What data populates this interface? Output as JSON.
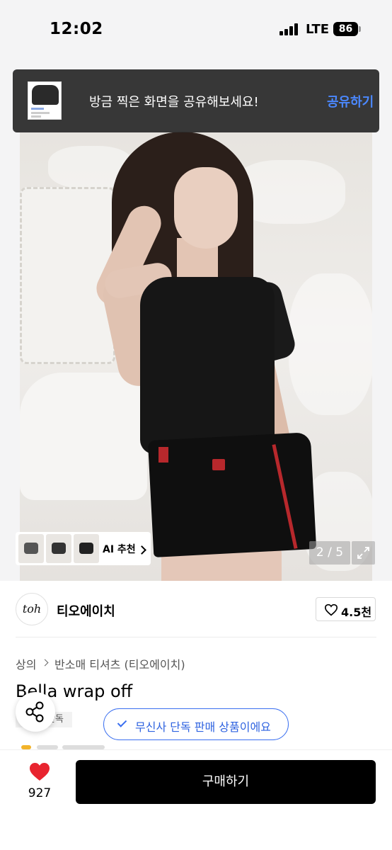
{
  "status_bar": {
    "time": "12:02",
    "network": "LTE",
    "battery": "86"
  },
  "share_toast": {
    "message": "방금 찍은 화면을 공유해보세요!",
    "action": "공유하기"
  },
  "gallery": {
    "ai_recommend_label": "AI 추천",
    "current_page": 2,
    "total_pages": 5,
    "pager_text": "2 / 5"
  },
  "brand": {
    "logo_text": "toh",
    "name": "티오에이치",
    "likes": "4.5천"
  },
  "breadcrumb": [
    "상의",
    "반소매 티셔츠 (티오에이치)"
  ],
  "product": {
    "title": "Bella wrap off",
    "exclusive_tag": "단독",
    "exclusive_banner": "무신사 단독 판매 상품이에요"
  },
  "bottom_bar": {
    "wish_count": "927",
    "buy_label": "구매하기"
  },
  "colors": {
    "accent_blue": "#3a6ff0",
    "toast_link": "#4b88ff",
    "heart_red": "#e8242f",
    "buy_button": "#000000"
  },
  "icons": [
    "signal-icon",
    "battery-icon",
    "chevron-right-icon",
    "expand-icon",
    "heart-outline-icon",
    "share-icon",
    "check-icon",
    "heart-filled-icon"
  ]
}
